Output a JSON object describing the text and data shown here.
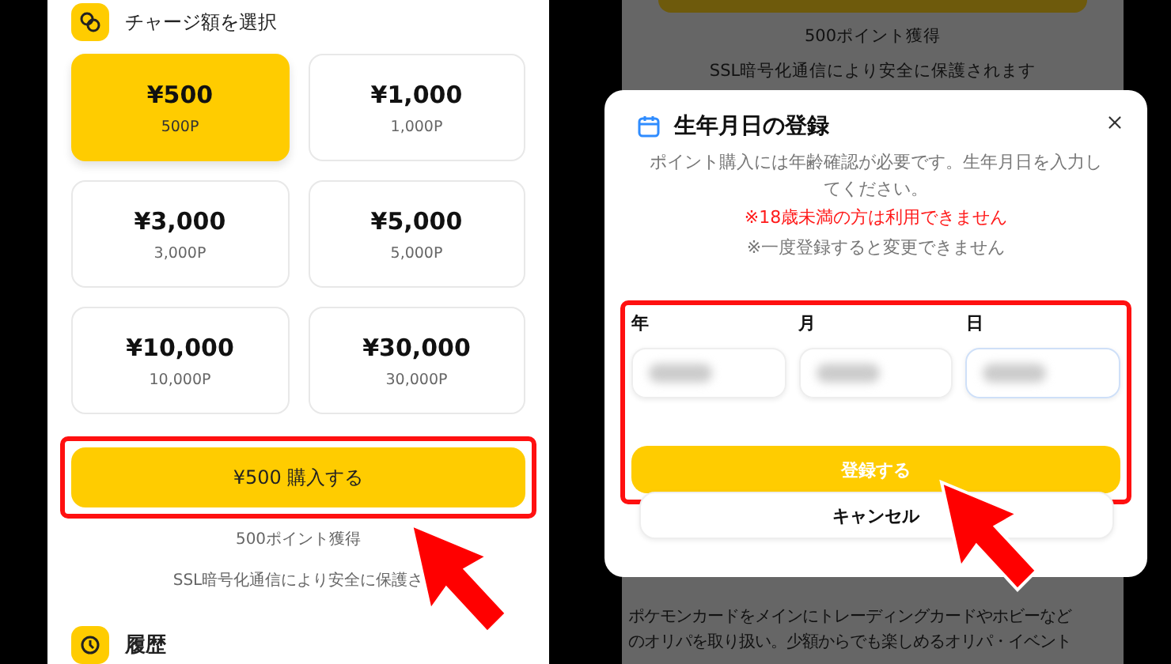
{
  "purchase_screen": {
    "section_title": "チャージ額を選択",
    "amounts": [
      {
        "price": "¥500",
        "points": "500P",
        "selected": true
      },
      {
        "price": "¥1,000",
        "points": "1,000P",
        "selected": false
      },
      {
        "price": "¥3,000",
        "points": "3,000P",
        "selected": false
      },
      {
        "price": "¥5,000",
        "points": "5,000P",
        "selected": false
      },
      {
        "price": "¥10,000",
        "points": "10,000P",
        "selected": false
      },
      {
        "price": "¥30,000",
        "points": "30,000P",
        "selected": false
      }
    ],
    "buy_button": "¥500 購入する",
    "points_note": "500ポイント獲得",
    "security_note": "SSL暗号化通信により安全に保護さ",
    "history_title": "履歴"
  },
  "background_screen": {
    "points_note": "500ポイント獲得",
    "security_note": "SSL暗号化通信により安全に保護されます",
    "description": "ポケモンカードをメインにトレーディングカードやホビーなどのオリパを取り扱い。少額からでも楽しめるオリパ・イベント"
  },
  "dialog": {
    "title": "生年月日の登録",
    "description": "ポイント購入には年齢確認が必要です。生年月日を入力してください。",
    "warning": "※18歳未満の方は利用できません",
    "note": "※一度登録すると変更できません",
    "fields": [
      {
        "label": "年",
        "focused": false
      },
      {
        "label": "月",
        "focused": false
      },
      {
        "label": "日",
        "focused": true
      }
    ],
    "submit": "登録する",
    "cancel": "キャンセル"
  }
}
